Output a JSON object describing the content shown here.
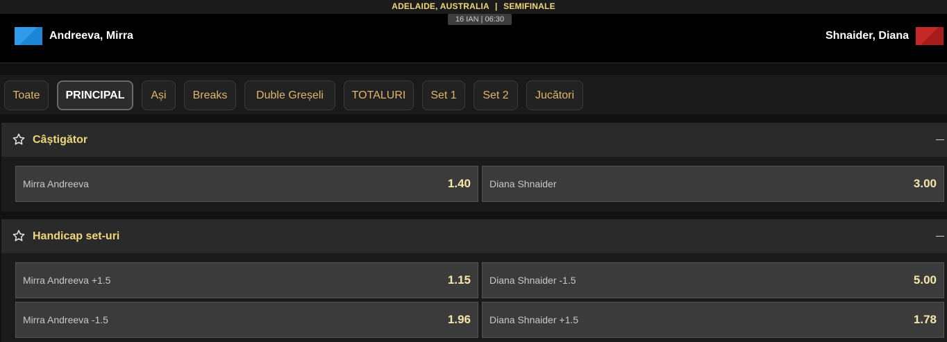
{
  "event": {
    "location": "ADELAIDE, AUSTRALIA",
    "separator": "|",
    "round": "SEMIFINALE",
    "datetime": "16 IAN | 06:30"
  },
  "teams": {
    "home": {
      "name": "Andreeva, Mirra",
      "flag_color": "#2f9be9"
    },
    "away": {
      "name": "Shnaider, Diana",
      "flag_color": "#c62828"
    }
  },
  "tabs": [
    {
      "label": "Toate"
    },
    {
      "label": "PRINCIPAL",
      "active": true
    },
    {
      "label": "Ași"
    },
    {
      "label": "Breaks"
    },
    {
      "label": "Duble Greșeli"
    },
    {
      "label": "TOTALURI"
    },
    {
      "label": "Set 1"
    },
    {
      "label": "Set 2"
    },
    {
      "label": "Jucători"
    }
  ],
  "markets": [
    {
      "title": "Câștigător",
      "rows": [
        [
          {
            "label": "Mirra Andreeva",
            "odd": "1.40"
          },
          {
            "label": "Diana Shnaider",
            "odd": "3.00"
          }
        ]
      ]
    },
    {
      "title": "Handicap set-uri",
      "rows": [
        [
          {
            "label": "Mirra Andreeva +1.5",
            "odd": "1.15"
          },
          {
            "label": "Diana Shnaider -1.5",
            "odd": "5.00"
          }
        ],
        [
          {
            "label": "Mirra Andreeva -1.5",
            "odd": "1.96"
          },
          {
            "label": "Diana Shnaider +1.5",
            "odd": "1.78"
          }
        ]
      ]
    }
  ],
  "colors": {
    "accent": "#f0d779",
    "tab_text": "#e0b76b",
    "odd_value": "#f6e7a8",
    "background": "#111111"
  }
}
